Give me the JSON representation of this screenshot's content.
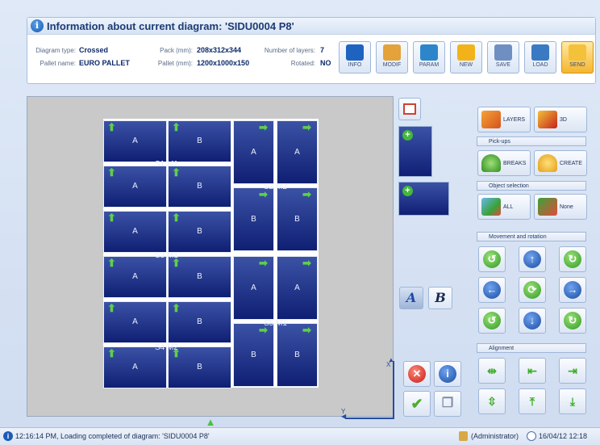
{
  "header": {
    "title": "Information about current diagram: 'SIDU0004 P8'",
    "diagram_type_label": "Diagram type:",
    "diagram_type_value": "Crossed",
    "pallet_name_label": "Pallet name:",
    "pallet_name_value": "EURO PALLET",
    "pack_label": "Pack (mm):",
    "pack_value": "208x312x344",
    "pallet_mm_label": "Pallet (mm):",
    "pallet_mm_value": "1200x1000x150",
    "layers_label": "Number of layers:",
    "layers_value": "7",
    "rotated_label": "Rotated:",
    "rotated_value": "NO"
  },
  "toolbar": [
    {
      "label": "INFO",
      "icon": "info-icon",
      "color": "#1e63bf"
    },
    {
      "label": "MODIF",
      "icon": "pencil-icon",
      "color": "#e3a33a"
    },
    {
      "label": "PARAM",
      "icon": "gear-icon",
      "color": "#2d86c9"
    },
    {
      "label": "NEW",
      "icon": "star-icon",
      "color": "#f2b21a"
    },
    {
      "label": "SAVE",
      "icon": "save-icon",
      "color": "#6f8fc2"
    },
    {
      "label": "LOAD",
      "icon": "load-icon",
      "color": "#3b7ac2"
    },
    {
      "label": "SEND",
      "icon": "send-icon",
      "color": "#f3c13a"
    }
  ],
  "diagram": {
    "boxes": [
      "A",
      "B",
      "A",
      "B",
      "A",
      "B",
      "A",
      "B",
      "A",
      "B",
      "A",
      "B",
      "A",
      "A",
      "B",
      "B",
      "A",
      "A",
      "B",
      "B"
    ],
    "groups": [
      "S1 M1",
      "S2 M2",
      "S3 M1",
      "S4 M2",
      "S5 M1"
    ]
  },
  "axes": {
    "x": "X",
    "y": "Y"
  },
  "buttons": {
    "layers": "LAYERS",
    "three_d": "3D",
    "pickups_header": "Pick-ups",
    "breaks": "BREAKS",
    "create": "CREATE",
    "object_selection_header": "Object selection",
    "all": "ALL",
    "none": "None",
    "movement_header": "Movement and rotation",
    "alignment_header": "Alignment",
    "a_label": "A",
    "b_label": "B"
  },
  "status": {
    "message": "12:16:14 PM, Loading completed of diagram: 'SIDU0004 P8'",
    "user": "(Administrator)",
    "datetime": "16/04/12 12:18"
  }
}
